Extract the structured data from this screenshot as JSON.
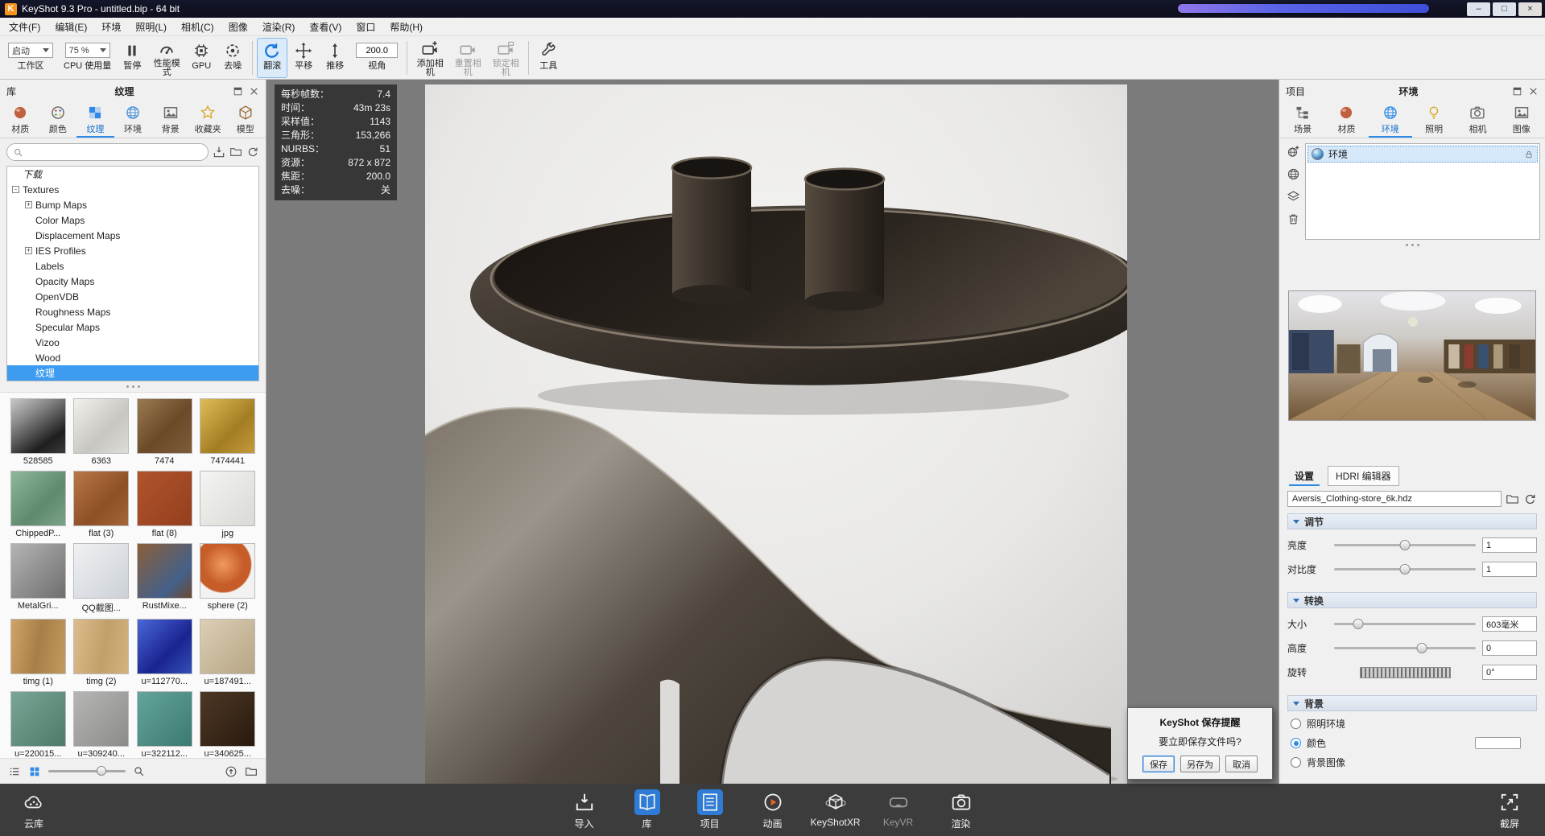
{
  "window": {
    "title": "KeyShot 9.3 Pro  - untitled.bip  - 64 bit",
    "logo_letter": "K",
    "controls": {
      "minimize": "–",
      "maximize": "□",
      "close": "×"
    }
  },
  "menubar": [
    "文件(F)",
    "编辑(E)",
    "环境",
    "照明(L)",
    "相机(C)",
    "图像",
    "渲染(R)",
    "查看(V)",
    "窗口",
    "帮助(H)"
  ],
  "toolbar": [
    {
      "kind": "dropdown",
      "value": "启动",
      "label": "工作区",
      "name": "startup"
    },
    {
      "kind": "dropdown",
      "value": "75 %",
      "label": "CPU 使用量",
      "name": "cpu-usage"
    },
    {
      "kind": "button",
      "icon": "pause",
      "label": "暂停",
      "name": "pause"
    },
    {
      "kind": "button",
      "icon": "gauge",
      "label": "性能模式",
      "name": "performance-mode",
      "wrap": true
    },
    {
      "kind": "button",
      "icon": "gpu",
      "label": "GPU",
      "name": "gpu"
    },
    {
      "kind": "button",
      "icon": "denoise",
      "label": "去噪",
      "name": "denoise"
    },
    {
      "kind": "sep"
    },
    {
      "kind": "button",
      "icon": "tumble",
      "label": "翻滚",
      "name": "tumble",
      "active": true
    },
    {
      "kind": "button",
      "icon": "pan",
      "label": "平移",
      "name": "pan"
    },
    {
      "kind": "button",
      "icon": "dolly",
      "label": "推移",
      "name": "dolly"
    },
    {
      "kind": "input",
      "value": "200.0",
      "label": "视角",
      "name": "fov"
    },
    {
      "kind": "sep"
    },
    {
      "kind": "button",
      "icon": "camera-plus",
      "label": "添加相机",
      "name": "add-camera",
      "wrap": true
    },
    {
      "kind": "button",
      "icon": "camera",
      "label": "重置相机",
      "name": "reset-camera",
      "wrap": true,
      "disabled": true
    },
    {
      "kind": "button",
      "icon": "camera-lock",
      "label": "锁定相机",
      "name": "lock-camera",
      "wrap": true,
      "disabled": true
    },
    {
      "kind": "sep"
    },
    {
      "kind": "button",
      "icon": "wrench",
      "label": "工具",
      "name": "tools"
    }
  ],
  "library": {
    "title": "库",
    "caption": "纹理",
    "tabs": [
      {
        "label": "材质",
        "icon": "sphere",
        "color": "#c06040"
      },
      {
        "label": "颜色",
        "icon": "palette",
        "color": "#666666"
      },
      {
        "label": "纹理",
        "icon": "checker",
        "color": "#2e8ae6",
        "active": true
      },
      {
        "label": "环境",
        "icon": "globe",
        "color": "#4a90d8"
      },
      {
        "label": "背景",
        "icon": "image",
        "color": "#666666"
      },
      {
        "label": "收藏夹",
        "icon": "star",
        "color": "#d8a828"
      },
      {
        "label": "模型",
        "icon": "cube",
        "color": "#996633"
      }
    ],
    "tree": [
      {
        "label": "下载",
        "depth": 0,
        "italic": true
      },
      {
        "label": "Textures",
        "depth": 0,
        "expander": "-"
      },
      {
        "label": "Bump Maps",
        "depth": 1,
        "expander": "+"
      },
      {
        "label": "Color Maps",
        "depth": 1
      },
      {
        "label": "Displacement Maps",
        "depth": 1
      },
      {
        "label": "IES Profiles",
        "depth": 1,
        "expander": "+"
      },
      {
        "label": "Labels",
        "depth": 1
      },
      {
        "label": "Opacity Maps",
        "depth": 1
      },
      {
        "label": "OpenVDB",
        "depth": 1
      },
      {
        "label": "Roughness Maps",
        "depth": 1
      },
      {
        "label": "Specular Maps",
        "depth": 1
      },
      {
        "label": "Vizoo",
        "depth": 1
      },
      {
        "label": "Wood",
        "depth": 1
      },
      {
        "label": "纹理",
        "depth": 1,
        "selected": true
      }
    ],
    "thumbnails": [
      {
        "label": "528585",
        "bg": "linear-gradient(145deg,#c8c8c8 0%,#8a8a8a 30%,#1e1e1e 75%,#3c3c3c 100%)"
      },
      {
        "label": "6363",
        "bg": "linear-gradient(135deg,#f1f0ec,#c7c6c0 60%,#dedcd6)"
      },
      {
        "label": "7474",
        "bg": "linear-gradient(135deg,#9a7a52,#6b4a28 55%,#7d5c38)"
      },
      {
        "label": "7474441",
        "bg": "linear-gradient(135deg,#e0bc58,#a37d22 60%,#c49a3c)"
      },
      {
        "label": "ChippedP...",
        "bg": "linear-gradient(135deg,#8fb89b,#5f8a6d 60%,#7aa287)"
      },
      {
        "label": "flat (3)",
        "bg": "linear-gradient(135deg,#b97848,#8e4f26 60%,#a5663a)"
      },
      {
        "label": "flat (8)",
        "bg": "linear-gradient(135deg,#b0542c,#943f1e)"
      },
      {
        "label": "jpg",
        "bg": "linear-gradient(135deg,#f4f4f2,#d9d9d5)"
      },
      {
        "label": "MetalGri...",
        "bg": "linear-gradient(135deg,#b4b4b4,#6e6e6e)"
      },
      {
        "label": "QQ截图...",
        "bg": "linear-gradient(135deg,#eff1f3,#ccd1d6)"
      },
      {
        "label": "RustMixe...",
        "bg": "linear-gradient(135deg,#8a5f38,#44608a 70%,#6b4a30)"
      },
      {
        "label": "sphere (2)",
        "bg": "radial-gradient(circle at 42% 38%,#f09a5e 0%,#c65c28 45%,#c65c28 60%,#f2f2f0 63%)"
      },
      {
        "label": "timg (1)",
        "bg": "linear-gradient(100deg,#cfa468,#a87e48 50%,#c29a5e)"
      },
      {
        "label": "timg (2)",
        "bg": "linear-gradient(100deg,#dcbc8c,#c2a06a 55%,#d2b27e)"
      },
      {
        "label": "u=112770...",
        "bg": "linear-gradient(135deg,#4a66d8,#1a2490 60%,#3450b8)"
      },
      {
        "label": "u=187491...",
        "bg": "linear-gradient(135deg,#dccfb4,#b6a585)"
      },
      {
        "label": "u=220015...",
        "bg": "linear-gradient(135deg,#79a696,#4f7a6a)"
      },
      {
        "label": "u=309240...",
        "bg": "linear-gradient(135deg,#b6b6b4,#8b8b89)"
      },
      {
        "label": "u=322112...",
        "bg": "linear-gradient(135deg,#64a49a,#3c7a70)"
      },
      {
        "label": "u=340625...",
        "bg": "linear-gradient(135deg,#4e3826,#281a0e)"
      }
    ]
  },
  "stats": {
    "rows": [
      {
        "label": "每秒帧数：",
        "value": "7.4"
      },
      {
        "label": "时间：",
        "value": "43m 23s"
      },
      {
        "label": "采样值：",
        "value": "1143"
      },
      {
        "label": "三角形：",
        "value": "153,266"
      },
      {
        "label": "NURBS：",
        "value": "51"
      },
      {
        "label": "资源：",
        "value": "872 x 872"
      },
      {
        "label": "焦距：",
        "value": "200.0"
      },
      {
        "label": "去噪：",
        "value": "关"
      }
    ]
  },
  "project": {
    "title": "项目",
    "caption": "环境",
    "tabs": [
      {
        "label": "场景",
        "icon": "scene",
        "color": "#666666"
      },
      {
        "label": "材质",
        "icon": "sphere",
        "color": "#c06040"
      },
      {
        "label": "环境",
        "icon": "globe",
        "color": "#2e8ae6",
        "active": true
      },
      {
        "label": "照明",
        "icon": "bulb",
        "color": "#d8a828"
      },
      {
        "label": "相机",
        "icon": "render-cam",
        "color": "#666666"
      },
      {
        "label": "图像",
        "icon": "image",
        "color": "#666666"
      }
    ],
    "env_tools": [
      {
        "name": "add-environment",
        "icon": "globe-plus"
      },
      {
        "name": "environment-sphere",
        "icon": "globe"
      },
      {
        "name": "flatten-layers",
        "icon": "layers"
      },
      {
        "name": "delete-environment",
        "icon": "trash"
      }
    ],
    "environment_item": {
      "label": "环境"
    },
    "settings_tabs": [
      {
        "label": "设置",
        "active": true
      },
      {
        "label": "HDRI 编辑器"
      }
    ],
    "hdri_file": "Aversis_Clothing-store_6k.hdz",
    "adjust": {
      "label": "调节",
      "rows": [
        {
          "label": "亮度",
          "value": "1",
          "percent": 50
        },
        {
          "label": "对比度",
          "value": "1",
          "percent": 50
        }
      ]
    },
    "transform": {
      "label": "转换",
      "rows": [
        {
          "label": "大小",
          "value": "603毫米",
          "percent": 17
        },
        {
          "label": "高度",
          "value": "0",
          "percent": 62
        },
        {
          "label": "旋转",
          "value": "0°",
          "ribbed": true
        }
      ]
    },
    "background": {
      "label": "背景",
      "options": [
        {
          "label": "照明环境"
        },
        {
          "label": "颜色",
          "selected": true,
          "swatch": "#ffffff"
        },
        {
          "label": "背景图像"
        }
      ]
    }
  },
  "dialog": {
    "title": "KeyShot 保存提醒",
    "message": "要立即保存文件吗?",
    "buttons": [
      "保存",
      "另存为",
      "取消"
    ]
  },
  "bottombar": {
    "cloud": {
      "label": "云库",
      "icon": "cloud-nodes",
      "name": "cloud-library"
    },
    "items": [
      {
        "label": "导入",
        "icon": "import",
        "name": "import"
      },
      {
        "label": "库",
        "icon": "book",
        "name": "library",
        "active": true
      },
      {
        "label": "项目",
        "icon": "list-doc",
        "name": "project",
        "active": true
      },
      {
        "label": "动画",
        "icon": "play",
        "name": "animation"
      },
      {
        "label": "KeyShotXR",
        "icon": "xr",
        "name": "keyshotxr"
      },
      {
        "label": "KeyVR",
        "icon": "vr",
        "name": "keyvr",
        "disabled": true
      },
      {
        "label": "渲染",
        "icon": "render-cam",
        "name": "render"
      }
    ],
    "screenshot": {
      "label": "截屏",
      "icon": "screenshot",
      "name": "screenshot"
    }
  },
  "colors": {
    "accent": "#2e8ae6",
    "titlebar": "#101223",
    "bottombar": "#3c3c3c",
    "selection": "#3d9bf0"
  }
}
